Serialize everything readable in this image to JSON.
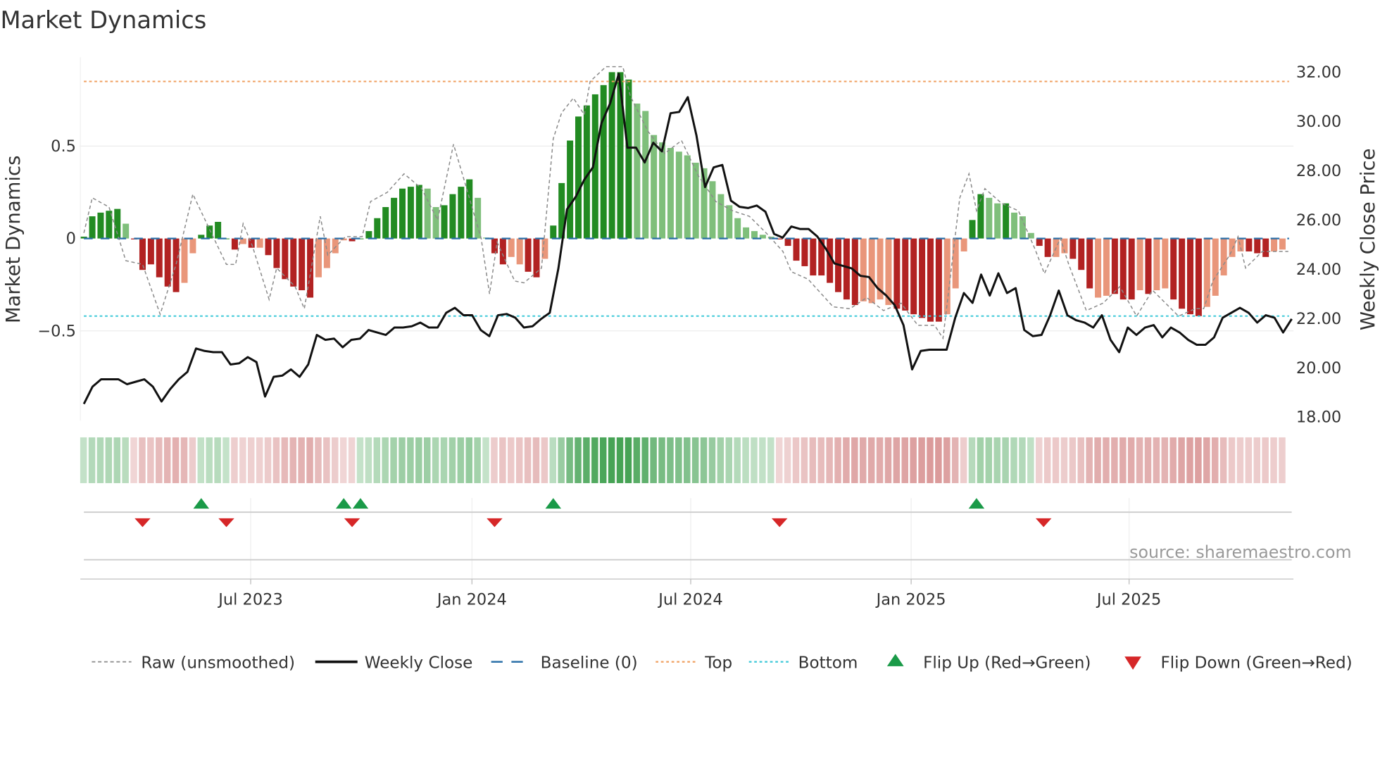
{
  "chart_data": {
    "type": "bar+line",
    "title": "Market Dynamics",
    "ylabel_left": "Market Dynamics",
    "ylabel_right": "Weekly Close Price",
    "source": "source: sharemaestro.com",
    "left_ylim": [
      -0.99,
      0.98
    ],
    "right_ylim": [
      17.7,
      32.5
    ],
    "left_ticks": [
      {
        "v": 0.5,
        "label": "0.5"
      },
      {
        "v": 0,
        "label": "0"
      },
      {
        "v": -0.5,
        "label": "−0.5"
      }
    ],
    "right_ticks": [
      {
        "v": 32,
        "label": "32.00"
      },
      {
        "v": 30,
        "label": "30.00"
      },
      {
        "v": 28,
        "label": "28.00"
      },
      {
        "v": 26,
        "label": "26.00"
      },
      {
        "v": 24,
        "label": "24.00"
      },
      {
        "v": 22,
        "label": "22.00"
      },
      {
        "v": 20,
        "label": "20.00"
      },
      {
        "v": 18,
        "label": "18.00"
      }
    ],
    "x_week_range": [
      0,
      144
    ],
    "x_ticks": [
      {
        "week": 19.9,
        "label": "Jul 2023"
      },
      {
        "week": 46.3,
        "label": "Jan 2024"
      },
      {
        "week": 72.4,
        "label": "Jul 2024"
      },
      {
        "week": 98.7,
        "label": "Jan 2025"
      },
      {
        "week": 124.7,
        "label": "Jul 2025"
      }
    ],
    "top_level": 0.85,
    "bottom_level": -0.42,
    "baseline": 0,
    "momentum": [
      0.01,
      0.12,
      0.14,
      0.15,
      0.16,
      0.08,
      -0.005,
      -0.17,
      -0.14,
      -0.21,
      -0.26,
      -0.29,
      -0.24,
      -0.08,
      0.02,
      0.07,
      0.09,
      0,
      -0.06,
      -0.03,
      -0.05,
      -0.05,
      -0.09,
      -0.16,
      -0.22,
      -0.26,
      -0.28,
      -0.32,
      -0.21,
      -0.16,
      -0.08,
      -0.01,
      -0.015,
      0,
      0.04,
      0.11,
      0.17,
      0.22,
      0.27,
      0.28,
      0.29,
      0.27,
      0.17,
      0.18,
      0.24,
      0.28,
      0.32,
      0.22,
      0.005,
      -0.08,
      -0.14,
      -0.1,
      -0.14,
      -0.18,
      -0.21,
      -0.11,
      0.07,
      0.3,
      0.53,
      0.66,
      0.72,
      0.78,
      0.83,
      0.9,
      0.9,
      0.86,
      0.73,
      0.69,
      0.56,
      0.52,
      0.49,
      0.47,
      0.45,
      0.41,
      0.38,
      0.31,
      0.24,
      0.18,
      0.11,
      0.06,
      0.04,
      0.02,
      0.01,
      -0.005,
      -0.04,
      -0.12,
      -0.15,
      -0.2,
      -0.2,
      -0.24,
      -0.29,
      -0.33,
      -0.36,
      -0.34,
      -0.35,
      -0.33,
      -0.36,
      -0.38,
      -0.39,
      -0.41,
      -0.43,
      -0.45,
      -0.45,
      -0.41,
      -0.27,
      -0.07,
      0.1,
      0.24,
      0.22,
      0.19,
      0.19,
      0.14,
      0.12,
      0.03,
      -0.04,
      -0.1,
      -0.1,
      -0.08,
      -0.11,
      -0.17,
      -0.27,
      -0.32,
      -0.31,
      -0.3,
      -0.33,
      -0.33,
      -0.28,
      -0.3,
      -0.28,
      -0.27,
      -0.33,
      -0.38,
      -0.41,
      -0.42,
      -0.37,
      -0.31,
      -0.2,
      -0.1,
      -0.07,
      -0.07,
      -0.08,
      -0.1,
      -0.07,
      -0.06
    ],
    "momentum_tones": "GGGGGgRRRRRRrrGGGGRrRrRRRRRRrrrrRGGGGGGGGgg GGGGggRRrrRRrGGGGGGGGGGgggggggggggggggggRRRRRRRRRRrrrrRRRRRRrrrGGggGggg RRrrRRRrrRRRrRrrRRRRrrrrrRRRrr",
    "tone_key": {
      "G": "rising positive",
      "g": "falling positive",
      "R": "falling negative",
      "r": "rising negative"
    },
    "weekly_close": [
      18.5,
      19.2,
      19.5,
      19.5,
      19.5,
      19.3,
      19.4,
      19.5,
      19.2,
      18.6,
      19.1,
      19.5,
      19.8,
      20.75,
      20.65,
      20.6,
      20.6,
      20.1,
      20.15,
      20.4,
      20.2,
      18.8,
      19.6,
      19.65,
      19.9,
      19.6,
      20.1,
      21.3,
      21.1,
      21.15,
      20.8,
      21.1,
      21.15,
      21.5,
      21.4,
      21.3,
      21.6,
      21.6,
      21.65,
      21.8,
      21.6,
      21.6,
      22.2,
      22.4,
      22.1,
      22.1,
      21.5,
      21.25,
      22.1,
      22.15,
      22.0,
      21.6,
      21.65,
      21.95,
      22.2,
      24.0,
      26.4,
      26.9,
      27.6,
      28.1,
      29.9,
      30.7,
      31.9,
      28.9,
      28.9,
      28.3,
      29.1,
      28.75,
      30.3,
      30.35,
      30.95,
      29.4,
      27.3,
      28.1,
      28.2,
      26.75,
      26.5,
      26.45,
      26.55,
      26.3,
      25.4,
      25.25,
      25.7,
      25.6,
      25.6,
      25.3,
      24.8,
      24.2,
      24.1,
      24.0,
      23.7,
      23.65,
      23.2,
      22.9,
      22.5,
      21.7,
      19.9,
      20.65,
      20.7,
      20.7,
      20.7,
      22.0,
      23.0,
      22.6,
      23.75,
      22.9,
      23.8,
      23.0,
      23.2,
      21.5,
      21.25,
      21.3,
      22.1,
      23.1,
      22.1,
      21.9,
      21.8,
      21.6,
      22.1,
      21.1,
      20.6,
      21.6,
      21.3,
      21.6,
      21.7,
      21.2,
      21.6,
      21.4,
      21.1,
      20.9,
      20.9,
      21.2,
      22.0,
      22.2,
      22.4,
      22.2,
      21.8,
      22.1,
      22.0,
      21.4,
      21.95
    ],
    "raw": [
      [
        0,
        0.03
      ],
      [
        1,
        0.22
      ],
      [
        3,
        0.17
      ],
      [
        5,
        -0.12
      ],
      [
        7,
        -0.14
      ],
      [
        9.1,
        -0.41
      ],
      [
        11,
        -0.14
      ],
      [
        13,
        0.24
      ],
      [
        15.2,
        0.03
      ],
      [
        17,
        -0.14
      ],
      [
        18.1,
        -0.14
      ],
      [
        19,
        0.08
      ],
      [
        20.1,
        -0.04
      ],
      [
        22.1,
        -0.33
      ],
      [
        23,
        -0.16
      ],
      [
        25.2,
        -0.26
      ],
      [
        26.3,
        -0.38
      ],
      [
        28.2,
        0.12
      ],
      [
        29.1,
        -0.09
      ],
      [
        31.2,
        0.01
      ],
      [
        33.2,
        0.01
      ],
      [
        34.2,
        0.2
      ],
      [
        36.2,
        0.25
      ],
      [
        38.2,
        0.35
      ],
      [
        40.3,
        0.27
      ],
      [
        42.2,
        0.1
      ],
      [
        44.1,
        0.51
      ],
      [
        45.6,
        0.28
      ],
      [
        47.4,
        0
      ],
      [
        48.4,
        -0.3
      ],
      [
        49.3,
        -0.02
      ],
      [
        51.4,
        -0.23
      ],
      [
        52.5,
        -0.24
      ],
      [
        54.6,
        -0.16
      ],
      [
        56,
        0.54
      ],
      [
        57,
        0.68
      ],
      [
        58.4,
        0.76
      ],
      [
        59.7,
        0.67
      ],
      [
        60.4,
        0.85
      ],
      [
        62.3,
        0.93
      ],
      [
        64.3,
        0.93
      ],
      [
        65.2,
        0.77
      ],
      [
        67.3,
        0.58
      ],
      [
        69.3,
        0.46
      ],
      [
        71.3,
        0.53
      ],
      [
        73.3,
        0.34
      ],
      [
        75.4,
        0.2
      ],
      [
        77.4,
        0.15
      ],
      [
        79.4,
        0.12
      ],
      [
        81.4,
        0.03
      ],
      [
        83.4,
        -0.07
      ],
      [
        84.4,
        -0.18
      ],
      [
        86.4,
        -0.22
      ],
      [
        89.4,
        -0.37
      ],
      [
        91.4,
        -0.38
      ],
      [
        93.4,
        -0.32
      ],
      [
        95.4,
        -0.39
      ],
      [
        97.5,
        -0.35
      ],
      [
        99.5,
        -0.47
      ],
      [
        101.5,
        -0.47
      ],
      [
        102.5,
        -0.54
      ],
      [
        104.5,
        0.22
      ],
      [
        105.6,
        0.35
      ],
      [
        106.5,
        0.15
      ],
      [
        107.5,
        0.27
      ],
      [
        109.5,
        0.19
      ],
      [
        111.5,
        0.15
      ],
      [
        113.5,
        -0.06
      ],
      [
        114.6,
        -0.19
      ],
      [
        116.5,
        0
      ],
      [
        117.5,
        -0.14
      ],
      [
        119.6,
        -0.39
      ],
      [
        121.6,
        -0.35
      ],
      [
        123.6,
        -0.26
      ],
      [
        125.6,
        -0.42
      ],
      [
        127.5,
        -0.28
      ],
      [
        130.6,
        -0.42
      ],
      [
        132.6,
        -0.38
      ],
      [
        133.6,
        -0.38
      ],
      [
        134.7,
        -0.23
      ],
      [
        136.7,
        -0.09
      ],
      [
        137.7,
        0.01
      ],
      [
        138.6,
        -0.16
      ],
      [
        140.6,
        -0.07
      ],
      [
        143.7,
        -0.07
      ]
    ],
    "flip_up_weeks": [
      14,
      31,
      33,
      56,
      106.5
    ],
    "flip_down_weeks": [
      7,
      17,
      32,
      49,
      83,
      114.5
    ],
    "legend": [
      {
        "key": "raw",
        "label": "Raw (unsmoothed)"
      },
      {
        "key": "close",
        "label": "Weekly Close"
      },
      {
        "key": "baseline",
        "label": "Baseline (0)"
      },
      {
        "key": "top",
        "label": "Top"
      },
      {
        "key": "bottom",
        "label": "Bottom"
      },
      {
        "key": "up",
        "label": "Flip Up (Red→Green)"
      },
      {
        "key": "down",
        "label": "Flip Down (Green→Red)"
      }
    ],
    "colors": {
      "G": "#228b22",
      "g": "#7fbf7b",
      "R": "#b22222",
      "r": "#e9967a",
      "close": "#111111",
      "raw": "#8a8a8a",
      "top": "#f0a060",
      "bottom": "#3cc8d8",
      "baseline": "#2a6fa8",
      "up": "#1a9a48",
      "down": "#d62728"
    }
  }
}
